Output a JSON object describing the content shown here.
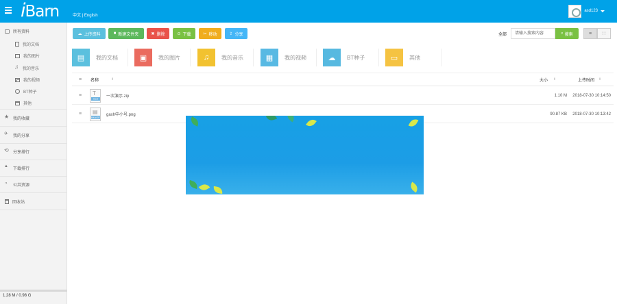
{
  "header": {
    "logo": "iBarn",
    "lang_zh": "中文",
    "lang_sep": "|",
    "lang_en": "English",
    "username": "asd123"
  },
  "sidebar": {
    "all_files": "所有资料",
    "sub_items": [
      {
        "label": "我的文档"
      },
      {
        "label": "我的图片"
      },
      {
        "label": "我的音乐"
      },
      {
        "label": "我的视频"
      },
      {
        "label": "BT种子"
      },
      {
        "label": "其他"
      }
    ],
    "items": [
      {
        "label": "我的收藏"
      },
      {
        "label": "我的分享"
      },
      {
        "label": "分享排行"
      },
      {
        "label": "下载排行"
      },
      {
        "label": "公共资源"
      },
      {
        "label": "回收站"
      }
    ],
    "storage": "1.28 M / 0.98 G",
    "storage_used_fraction": 0.001
  },
  "toolbar": {
    "upload": "上传资料",
    "new_folder": "新建文件夹",
    "delete": "删除",
    "download": "下载",
    "move": "移动",
    "share": "分享"
  },
  "search": {
    "label": "全部",
    "placeholder": "请输入搜索内容",
    "button": "搜索"
  },
  "categories": [
    {
      "label": "我的文档",
      "color": "#5bc0de"
    },
    {
      "label": "我的图片",
      "color": "#ea6b5f"
    },
    {
      "label": "我的音乐",
      "color": "#f2c230"
    },
    {
      "label": "我的视频",
      "color": "#58b9e3"
    },
    {
      "label": "BT种子",
      "color": "#57b9e0"
    },
    {
      "label": "其他",
      "color": "#f5c342"
    }
  ],
  "table": {
    "headers": {
      "name": "名称",
      "size": "大小",
      "date": "上传时间"
    },
    "rows": [
      {
        "name": "一次演示.zip",
        "size": "1.10 M",
        "date": "2018-07-30 10:14:50",
        "tag": "TXT"
      },
      {
        "name": "gaxh中小号.png",
        "size": "90.87 KB",
        "date": "2018-07-30 10:13:42",
        "tag": "IMAGE"
      }
    ]
  },
  "colors": {
    "topbar": "#00a2e8",
    "accent_green": "#7ac143",
    "danger": "#e9534a"
  }
}
